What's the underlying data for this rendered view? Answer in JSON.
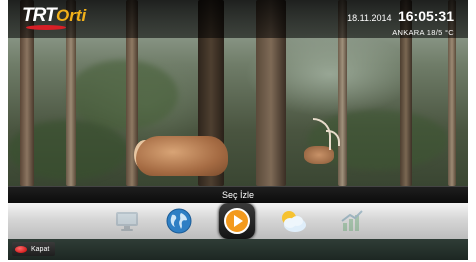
{
  "brand": {
    "logo_text_primary": "TRT",
    "logo_text_secondary": "Orti"
  },
  "status": {
    "date": "18.11.2014",
    "time": "16:05:31",
    "location": "ANKARA 18/5 °C"
  },
  "menu": {
    "selected_label": "Seç İzle",
    "items": [
      {
        "icon": "tv-icon",
        "active": false
      },
      {
        "icon": "globe-icon",
        "active": false
      },
      {
        "icon": "play-icon",
        "active": true
      },
      {
        "icon": "weather-icon",
        "active": false
      },
      {
        "icon": "chart-icon",
        "active": false
      }
    ]
  },
  "footer": {
    "close_label": "Kapat",
    "close_key_color": "red"
  },
  "colors": {
    "accent_orange": "#f39a1e",
    "brand_red": "#d71f26",
    "brand_gold": "#f2b11a"
  }
}
